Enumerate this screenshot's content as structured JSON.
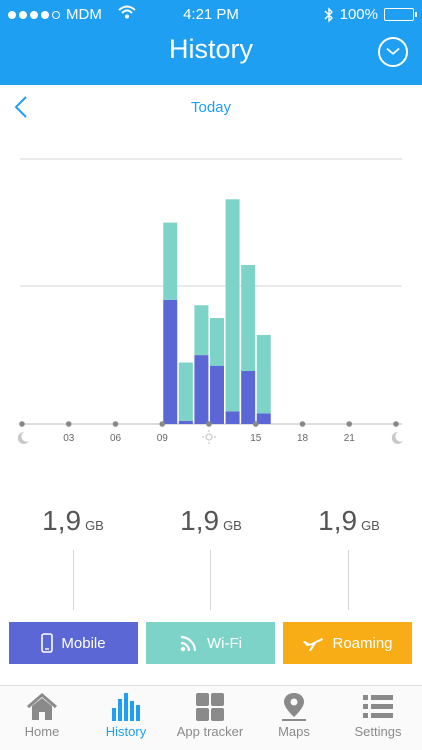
{
  "status_bar": {
    "carrier": "MDM",
    "time": "4:21 PM",
    "battery": "100%"
  },
  "header": {
    "title": "History"
  },
  "date_nav": {
    "label": "Today"
  },
  "chart_data": {
    "type": "bar",
    "stacked": true,
    "x_tick_labels": [
      "03",
      "06",
      "09",
      "15",
      "18",
      "21"
    ],
    "hours": [
      9,
      10,
      11,
      12,
      13,
      14,
      15,
      16
    ],
    "series": [
      {
        "color": "#5b67d4",
        "values": [
          117,
          3,
          65,
          55,
          12,
          50,
          10,
          0
        ]
      },
      {
        "color": "#7ed3c8",
        "values": [
          73,
          55,
          47,
          45,
          200,
          100,
          74,
          0
        ]
      }
    ],
    "grid": true,
    "colors": {
      "mobile": "#5b67d4",
      "wifi": "#7ed3c8"
    }
  },
  "totals": [
    {
      "value": "1,9",
      "unit": "GB"
    },
    {
      "value": "1,9",
      "unit": "GB"
    },
    {
      "value": "1,9",
      "unit": "GB"
    }
  ],
  "filters": {
    "mobile": {
      "label": "Mobile",
      "icon": "phone-icon",
      "color": "#5b67d4"
    },
    "wifi": {
      "label": "Wi-Fi",
      "icon": "wifi-signal-icon",
      "color": "#7ed3c8"
    },
    "roaming": {
      "label": "Roaming",
      "icon": "airplane-icon",
      "color": "#f8ad16"
    }
  },
  "tabs": [
    {
      "label": "Home",
      "icon": "home-icon"
    },
    {
      "label": "History",
      "icon": "bar-chart-icon",
      "active": true
    },
    {
      "label": "App tracker",
      "icon": "grid-icon"
    },
    {
      "label": "Maps",
      "icon": "map-pin-icon"
    },
    {
      "label": "Settings",
      "icon": "list-icon"
    }
  ],
  "colors": {
    "brand": "#1e9ff2"
  }
}
